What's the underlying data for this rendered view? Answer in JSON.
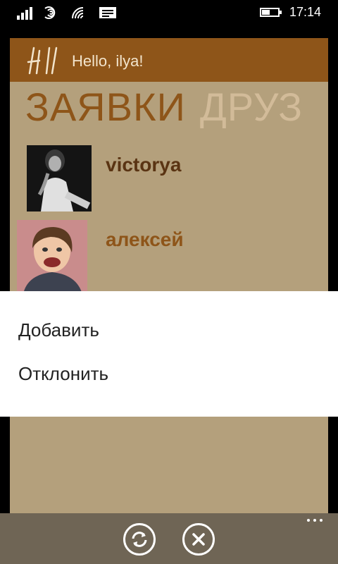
{
  "status_bar": {
    "time": "17:14",
    "battery_level": 0.45,
    "icons": [
      "signal-icon",
      "data-icon",
      "wifi-icon",
      "message-icon",
      "battery-icon"
    ]
  },
  "app": {
    "logo_text": "HI",
    "greeting": "Hello, ilya!",
    "title": "ЗАЯВКИ",
    "next_title": "ДРУЗ",
    "friends": [
      {
        "name": "victorya",
        "avatar": "avatar-photo"
      },
      {
        "name": "алексей",
        "avatar": "avatar-photo"
      }
    ]
  },
  "context_menu": {
    "items": [
      "Добавить",
      "Отклонить"
    ]
  },
  "app_bar": {
    "buttons": [
      "refresh-icon",
      "close-icon"
    ],
    "more": "more-icon"
  },
  "colors": {
    "header": "#8e5519",
    "background": "#b4a07c",
    "title_inactive": "#d2bb99"
  }
}
